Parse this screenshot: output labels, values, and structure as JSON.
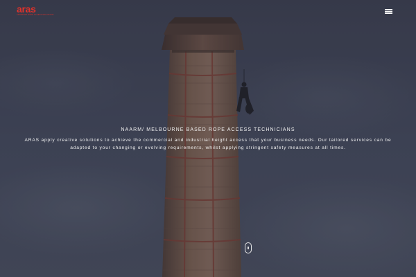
{
  "header": {
    "logo": {
      "text": "aras",
      "tagline": "ADVANCED ROPE ACCESS SOLUTIONS"
    },
    "menu_icon": "hamburger-menu-icon"
  },
  "hero": {
    "headline": "NAARM/ MELBOURNE BASED ROPE ACCESS TECHNICIANS",
    "intro": "ARAS apply creative solutions to achieve the commercial and industrial height access that your business needs. Our tailored services can be adapted to your changing or evolving requirements, whilst applying stringent safety measures at all times.",
    "scroll_icon": "scroll-down-mouse-icon"
  },
  "colors": {
    "brand": "#e0322b",
    "overlay": "#3a3e4e",
    "text": "#f2f2f2"
  }
}
